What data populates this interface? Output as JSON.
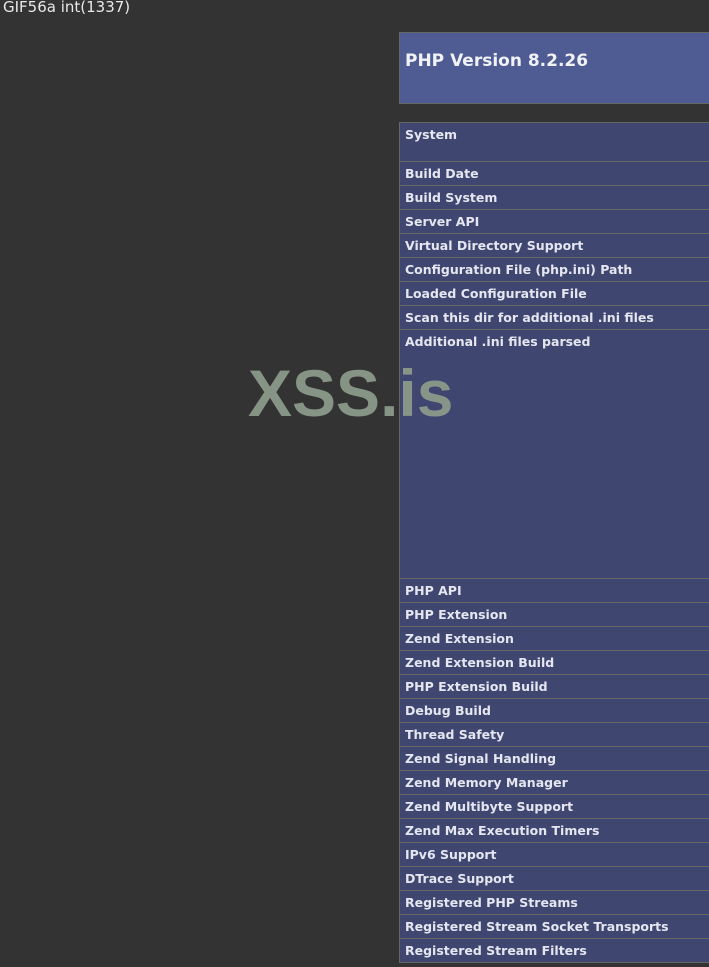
{
  "top_output": "GIF56a int(1337)",
  "watermark": "XSS.is",
  "header": {
    "title": "PHP Version 8.2.26"
  },
  "rows": [
    {
      "label": "System"
    },
    {
      "label": "Build Date"
    },
    {
      "label": "Build System"
    },
    {
      "label": "Server API"
    },
    {
      "label": "Virtual Directory Support"
    },
    {
      "label": "Configuration File (php.ini) Path"
    },
    {
      "label": "Loaded Configuration File"
    },
    {
      "label": "Scan this dir for additional .ini files"
    },
    {
      "label": "Additional .ini files parsed"
    },
    {
      "label": "PHP API"
    },
    {
      "label": "PHP Extension"
    },
    {
      "label": "Zend Extension"
    },
    {
      "label": "Zend Extension Build"
    },
    {
      "label": "PHP Extension Build"
    },
    {
      "label": "Debug Build"
    },
    {
      "label": "Thread Safety"
    },
    {
      "label": "Zend Signal Handling"
    },
    {
      "label": "Zend Memory Manager"
    },
    {
      "label": "Zend Multibyte Support"
    },
    {
      "label": "Zend Max Execution Timers"
    },
    {
      "label": "IPv6 Support"
    },
    {
      "label": "DTrace Support"
    },
    {
      "label": "Registered PHP Streams"
    },
    {
      "label": "Registered Stream Socket Transports"
    },
    {
      "label": "Registered Stream Filters"
    }
  ],
  "colors": {
    "background": "#333333",
    "header_bg": "#4f5b93",
    "row_bg": "#3f4770",
    "watermark": "#8a9a8a"
  }
}
